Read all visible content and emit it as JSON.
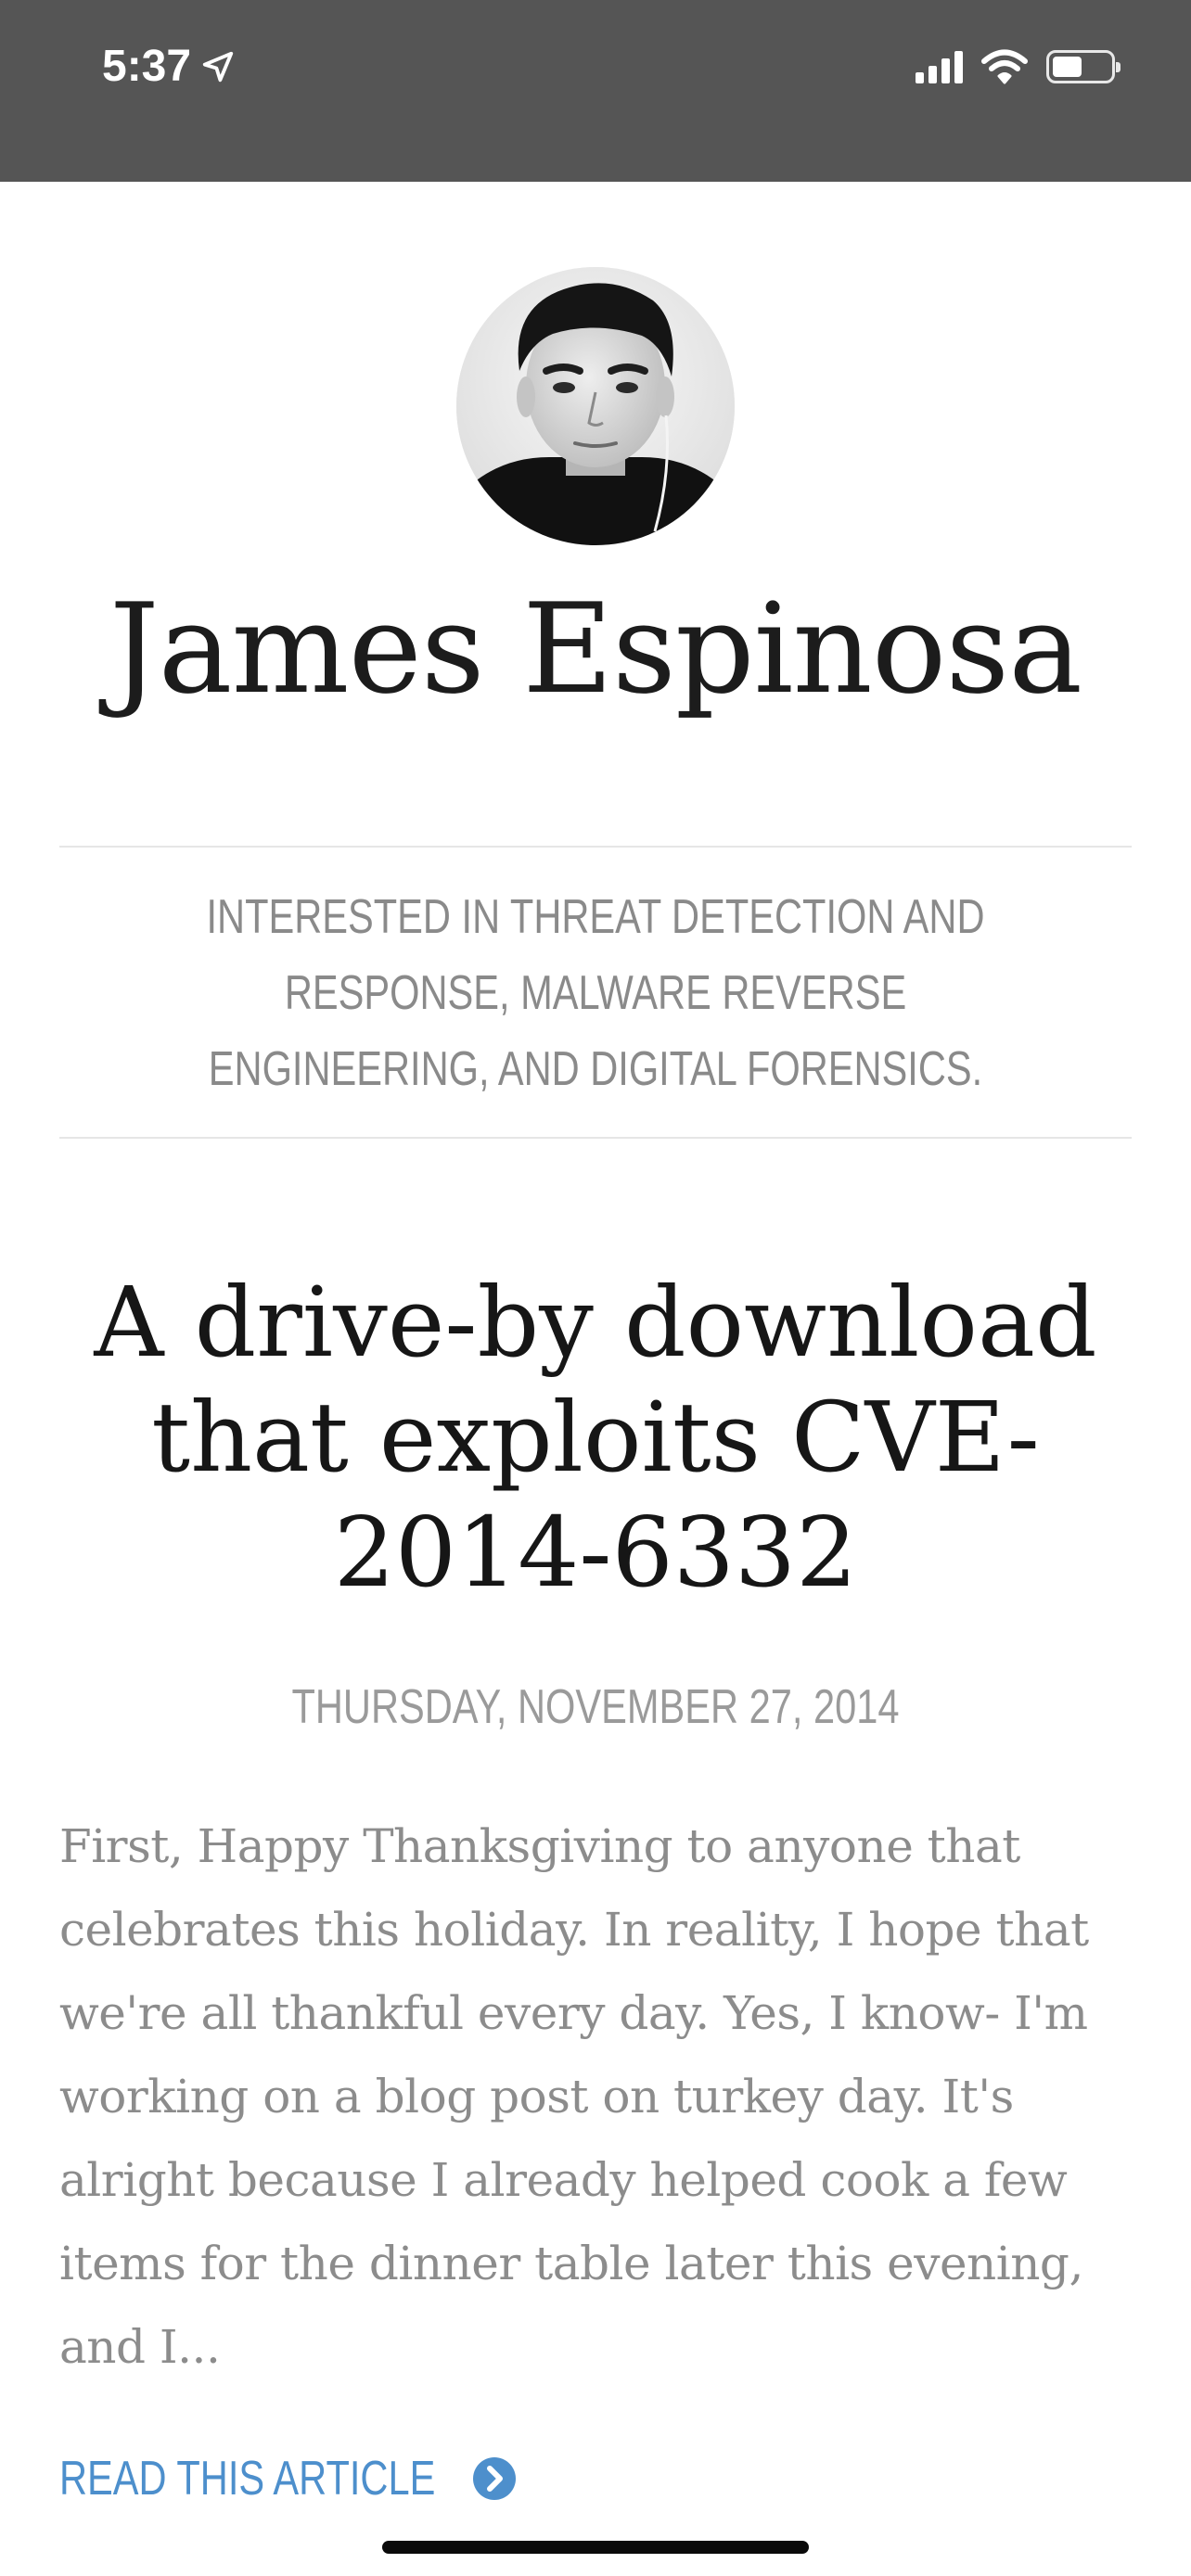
{
  "status_bar": {
    "time": "5:37",
    "icons": [
      "location-arrow-icon",
      "cellular-signal-icon",
      "wifi-icon",
      "battery-icon"
    ],
    "battery_level": 0.5
  },
  "header": {
    "avatar": "profile-photo",
    "site_title": "James Espinosa",
    "tagline": "INTERESTED IN THREAT DETECTION AND RESPONSE, MALWARE REVERSE ENGINEERING, AND DIGITAL FORENSICS."
  },
  "article": {
    "title": "A drive-by download that exploits CVE-2014-6332",
    "date": "THURSDAY, NOVEMBER 27, 2014",
    "excerpt": "First, Happy Thanksgiving to anyone that celebrates this holiday. In reality, I hope that we're all thankful every day. Yes, I know- I'm working on a blog post on turkey day. It's alright because I already helped cook a few items for the dinner table later this evening, and I...",
    "read_more_label": "READ THIS ARTICLE",
    "read_more_icon": "chevron-right-circle-icon"
  },
  "colors": {
    "status_bar_bg": "#555555",
    "title_text": "#1c1c1c",
    "muted_text": "#8a8a8a",
    "link": "#4d8fcc"
  }
}
